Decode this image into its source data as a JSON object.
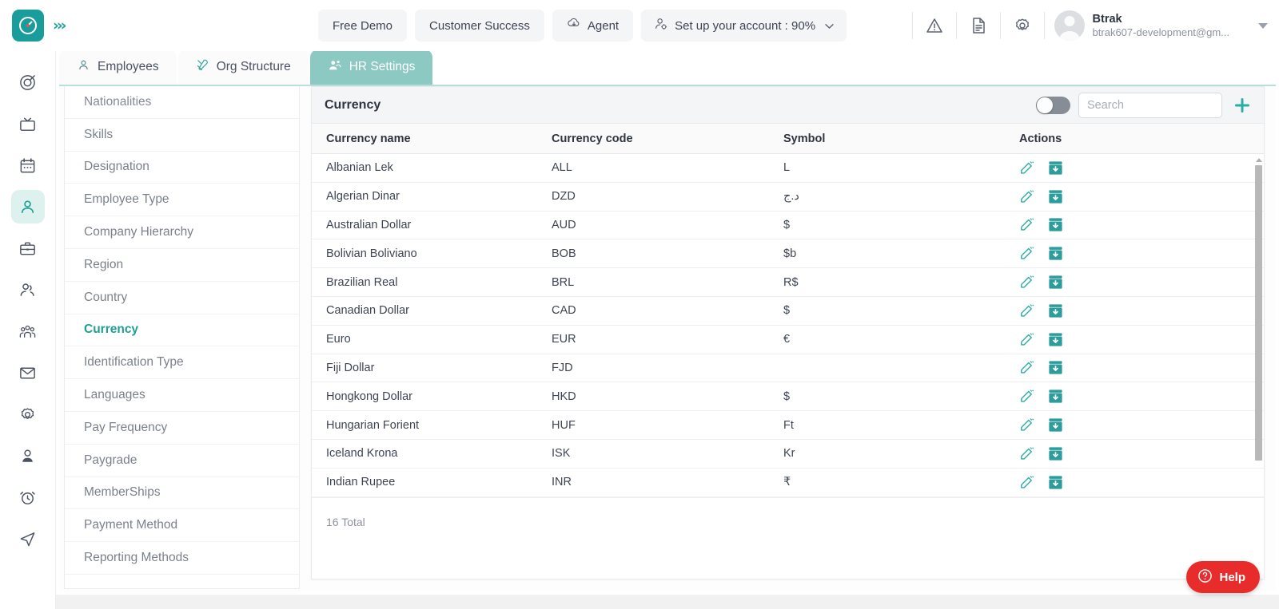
{
  "topbar": {
    "logo_icon": "clock-logo-icon",
    "collapse_icon": "collapse-chevrons-icon",
    "collapse_glyph": "›››",
    "buttons": [
      {
        "label": "Free Demo",
        "name": "free-demo-button",
        "icon": ""
      },
      {
        "label": "Customer Success",
        "name": "customer-success-button",
        "icon": ""
      },
      {
        "label": "Agent",
        "name": "agent-button",
        "icon": "agent-download-icon"
      },
      {
        "label": "Set up your account : 90%",
        "name": "setup-account-button",
        "icon": "user-settings-icon"
      }
    ],
    "icons": [
      {
        "name": "warning-icon"
      },
      {
        "name": "document-icon"
      },
      {
        "name": "gear-icon"
      }
    ],
    "user": {
      "name": "Btrak",
      "email": "btrak607-development@gm...",
      "avatar_name": "avatar"
    }
  },
  "rail": {
    "items": [
      {
        "name": "sidebar-rail-target-icon",
        "icon": "target-icon",
        "active": false
      },
      {
        "name": "sidebar-rail-tv-icon",
        "icon": "tv-icon",
        "active": false
      },
      {
        "name": "sidebar-rail-calendar-icon",
        "icon": "calendar-icon",
        "active": false
      },
      {
        "name": "sidebar-rail-person-icon",
        "icon": "person-icon",
        "active": true
      },
      {
        "name": "sidebar-rail-briefcase-icon",
        "icon": "briefcase-icon",
        "active": false
      },
      {
        "name": "sidebar-rail-users-icon",
        "icon": "users-icon",
        "active": false
      },
      {
        "name": "sidebar-rail-team-icon",
        "icon": "team-icon",
        "active": false
      },
      {
        "name": "sidebar-rail-mail-icon",
        "icon": "mail-icon",
        "active": false
      },
      {
        "name": "sidebar-rail-settings-icon",
        "icon": "gear-icon",
        "active": false
      },
      {
        "name": "sidebar-rail-profile-icon",
        "icon": "profile-icon",
        "active": false
      },
      {
        "name": "sidebar-rail-alarm-icon",
        "icon": "alarm-clock-icon",
        "active": false
      },
      {
        "name": "sidebar-rail-send-icon",
        "icon": "send-icon",
        "active": false
      }
    ]
  },
  "tabs": [
    {
      "label": "Employees",
      "name": "tab-employees",
      "icon": "person-icon",
      "active": false
    },
    {
      "label": "Org Structure",
      "name": "tab-org-structure",
      "icon": "tools-icon",
      "active": false
    },
    {
      "label": "HR Settings",
      "name": "tab-hr-settings",
      "icon": "people-gear-icon",
      "active": true
    }
  ],
  "settings_nav": {
    "items": [
      {
        "label": "Nationalities",
        "active": false
      },
      {
        "label": "Skills",
        "active": false
      },
      {
        "label": "Designation",
        "active": false
      },
      {
        "label": "Employee Type",
        "active": false
      },
      {
        "label": "Company Hierarchy",
        "active": false
      },
      {
        "label": "Region",
        "active": false
      },
      {
        "label": "Country",
        "active": false
      },
      {
        "label": "Currency",
        "active": true
      },
      {
        "label": "Identification Type",
        "active": false
      },
      {
        "label": "Languages",
        "active": false
      },
      {
        "label": "Pay Frequency",
        "active": false
      },
      {
        "label": "Paygrade",
        "active": false
      },
      {
        "label": "MemberShips",
        "active": false
      },
      {
        "label": "Payment Method",
        "active": false
      },
      {
        "label": "Reporting Methods",
        "active": false
      }
    ]
  },
  "content": {
    "title": "Currency",
    "toggle_state": "off",
    "search_placeholder": "Search",
    "search_value": "",
    "add_icon": "plus-icon",
    "columns": [
      "Currency name",
      "Currency code",
      "Symbol",
      "Actions"
    ],
    "rows": [
      {
        "name": "Albanian Lek",
        "code": "ALL",
        "symbol": "L"
      },
      {
        "name": "Algerian Dinar",
        "code": "DZD",
        "symbol": "د.ج"
      },
      {
        "name": "Australian Dollar",
        "code": "AUD",
        "symbol": "$"
      },
      {
        "name": "Bolivian Boliviano",
        "code": "BOB",
        "symbol": "$b"
      },
      {
        "name": "Brazilian Real",
        "code": "BRL",
        "symbol": "R$"
      },
      {
        "name": "Canadian Dollar",
        "code": "CAD",
        "symbol": "$"
      },
      {
        "name": "Euro",
        "code": "EUR",
        "symbol": "€"
      },
      {
        "name": "Fiji Dollar",
        "code": "FJD",
        "symbol": ""
      },
      {
        "name": "Hongkong Dollar",
        "code": "HKD",
        "symbol": "$"
      },
      {
        "name": "Hungarian Forient",
        "code": "HUF",
        "symbol": "Ft"
      },
      {
        "name": "Iceland Krona",
        "code": "ISK",
        "symbol": "Kr"
      },
      {
        "name": "Indian Rupee",
        "code": "INR",
        "symbol": "₹"
      }
    ],
    "row_actions": {
      "edit_icon": "edit-icon",
      "archive_icon": "archive-icon"
    },
    "total_label": "16 Total"
  },
  "help": {
    "label": "Help",
    "icon": "question-circle-icon"
  },
  "colors": {
    "brand_teal": "#189c9c",
    "accent_teal": "#2aada3",
    "tab_active": "#8bc9c2",
    "rail_active_bg": "#ddf1ee",
    "highlight_red": "#fd0d0d",
    "help_red": "#e82c2c"
  }
}
